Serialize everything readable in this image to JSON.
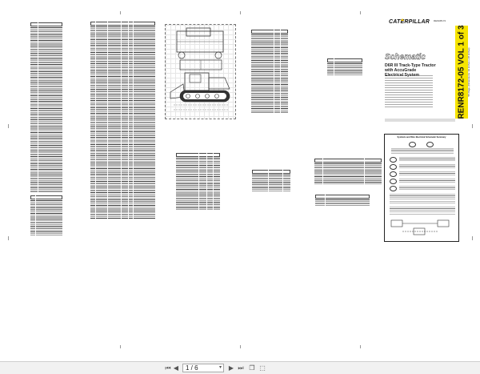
{
  "sheet": {
    "brand": "CATERPILLAR",
    "brand_note": "RENR8172",
    "title": "Schematic",
    "subtitle_lines": [
      "D6R III Track-Type Tractor",
      "with AccuGrade",
      "Electrical System"
    ],
    "doc_number": "RENR8172-05 VOL 1 of 3",
    "doc_sub": "55 Page, (Dimensions: 39 inches x 28 inches)",
    "summary_title": "Symbols and Wire Electrical Schematic Summary"
  },
  "toolbar": {
    "first_icon": "first-page-icon",
    "prev_icon": "prev-page-icon",
    "page_value": "1 / 6",
    "next_icon": "next-page-icon",
    "last_icon": "last-page-icon",
    "fit_icon": "fit-page-icon",
    "rotate_icon": "rotate-icon"
  }
}
